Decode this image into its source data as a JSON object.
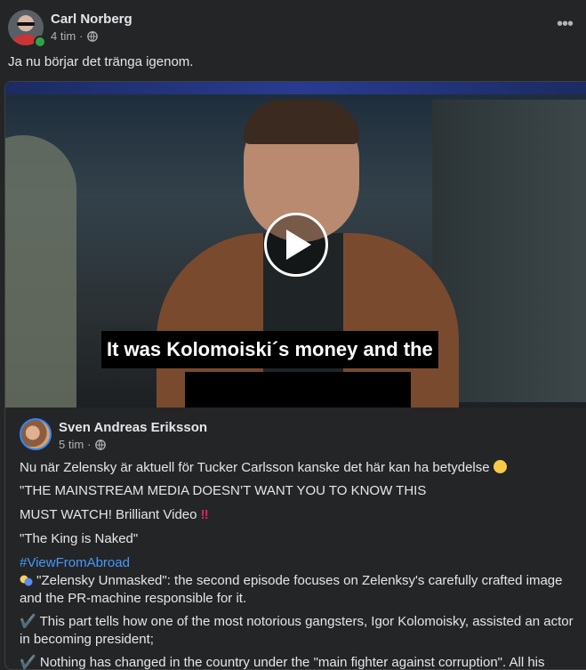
{
  "post": {
    "author": "Carl Norberg",
    "time": "4 tim",
    "separator": "·",
    "text": "Ja nu börjar det tränga igenom.",
    "more_label": "•••"
  },
  "video": {
    "subtitle": "It was Kolomoiski´s  money and the"
  },
  "shared": {
    "author": "Sven Andreas Eriksson",
    "time": "5 tim",
    "separator": "·",
    "line1": "Nu när Zelensky är aktuell för Tucker Carlsson kanske det här kan ha betydelse",
    "line2": "\"THE MAINSTREAM MEDIA DOESN’T WANT YOU TO KNOW THIS",
    "line3": "MUST WATCH! Brilliant Video",
    "line4": "\"The King is Naked\"",
    "hashtag": "#ViewFromAbroad",
    "line5": "\"Zelensky Unmasked\": the second episode focuses on Zelenksy's carefully crafted image and the PR-machine responsible for it.",
    "line6": "This part tells how one of the most notorious gangsters, Igor Kolomoisky, assisted an actor in becoming president;",
    "line7": "Nothing has changed in the country under the \"main fighter against corruption\". All his",
    "bangbang": "‼",
    "check": "✔️"
  },
  "colors": {
    "background": "#242526",
    "text": "#e4e6eb",
    "muted": "#b0b3b8",
    "link": "#4599ff",
    "online": "#31a24c"
  },
  "icons": [
    "globe-icon",
    "play-icon",
    "more-icon",
    "wink-emoji",
    "mask-emoji",
    "double-exclamation-emoji",
    "check-icon"
  ]
}
